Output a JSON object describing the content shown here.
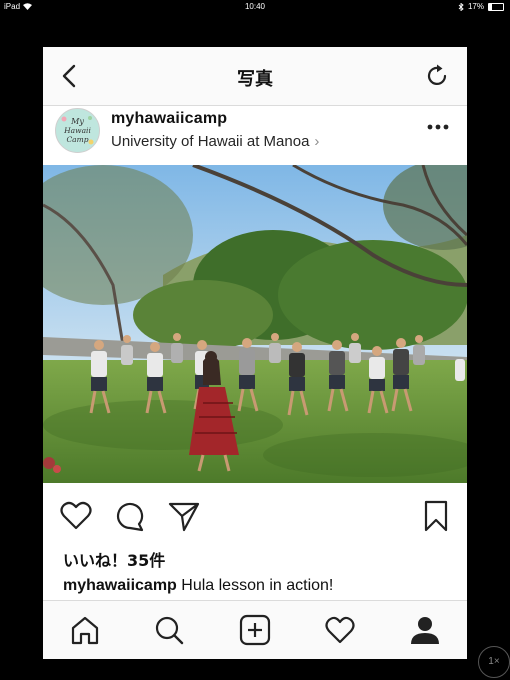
{
  "status_bar": {
    "device": "iPad",
    "time": "10:40",
    "battery_percent": "17%",
    "battery_level": 0.17
  },
  "nav": {
    "title": "写真",
    "back_icon": "chevron-left-icon",
    "refresh_icon": "refresh-icon"
  },
  "post": {
    "username": "myhawaiicamp",
    "location": "University of Hawaii at Manoa",
    "avatar_text": [
      "My",
      "Hawaii",
      "Camp"
    ],
    "photo_description": "Group hula lesson on a lawn under trees",
    "likes": "いいね！35件",
    "caption_user": "myhawaiicamp",
    "caption_text": " Hula lesson in action!"
  },
  "actions": [
    "heart-icon",
    "comment-icon",
    "share-icon",
    "bookmark-icon"
  ],
  "tabbar": [
    "home-icon",
    "search-icon",
    "add-post-icon",
    "activity-heart-icon",
    "profile-icon"
  ],
  "zoom_label": "1×",
  "colors": {
    "accent_text": "#111111",
    "secondary_text": "#8e8e8e",
    "bar_bg": "#fafafa"
  }
}
